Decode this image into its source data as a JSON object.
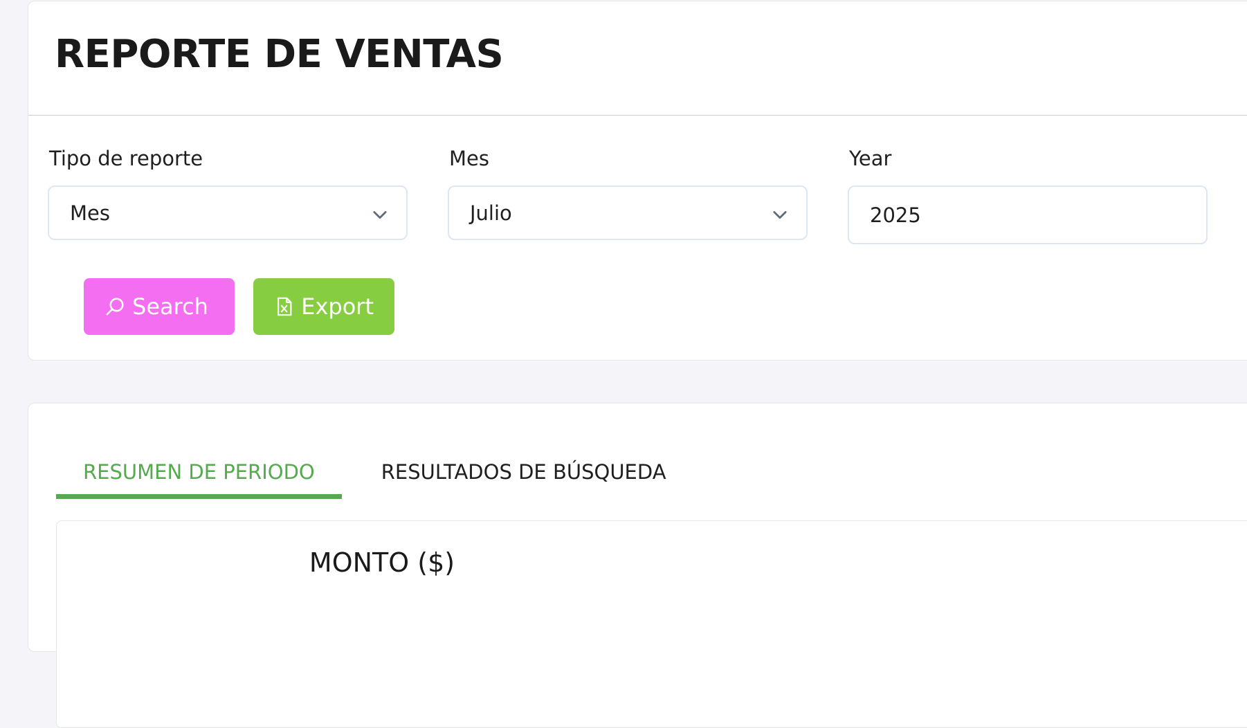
{
  "header": {
    "title": "REPORTE DE VENTAS"
  },
  "filters": {
    "report_type": {
      "label": "Tipo de reporte",
      "value": "Mes"
    },
    "month": {
      "label": "Mes",
      "value": "Julio"
    },
    "year": {
      "label": "Year",
      "value": "2025"
    }
  },
  "actions": {
    "search_label": "Search",
    "export_label": "Export"
  },
  "tabs": [
    {
      "label": "RESUMEN DE PERIODO",
      "active": true
    },
    {
      "label": "RESULTADOS DE BÚSQUEDA",
      "active": false
    }
  ],
  "panel": {
    "title": "MONTO ($)"
  },
  "colors": {
    "search_button": "#f36ef1",
    "export_button": "#86cd42",
    "active_tab": "#54aa4d",
    "page_background": "#f5f5f9"
  },
  "icons": {
    "search": "search-icon",
    "export": "excel-file-icon",
    "select_arrow": "chevron-down-icon"
  }
}
